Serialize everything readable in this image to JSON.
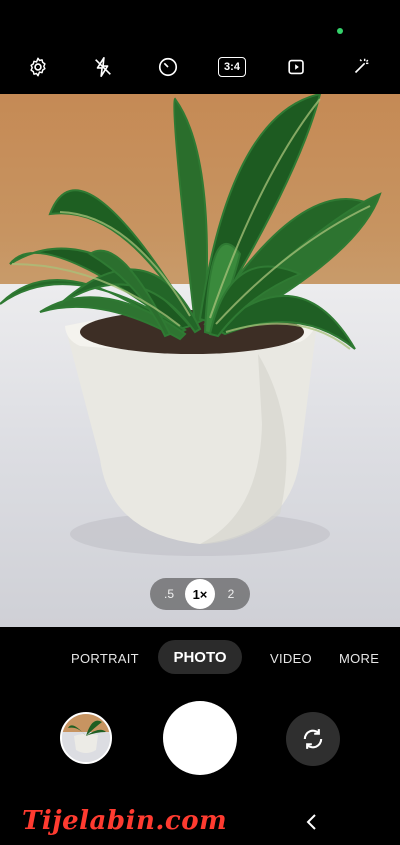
{
  "top_bar": {
    "icons": [
      "settings-icon",
      "flash-off-icon",
      "timer-icon",
      "ratio-icon",
      "motion-photo-icon",
      "filter-magic-icon"
    ],
    "ratio_label": "3:4"
  },
  "zoom": {
    "options": [
      ".5",
      "1×",
      "2"
    ],
    "selected": "1×"
  },
  "modes": {
    "items": [
      "PORTRAIT",
      "PHOTO",
      "VIDEO",
      "MORE"
    ],
    "selected": "PHOTO"
  },
  "watermark": "Tijelabin.com",
  "colors": {
    "accent_dot": "#35d26b",
    "mode_pill": "#2b2b2b",
    "watermark": "#ff3b30"
  }
}
